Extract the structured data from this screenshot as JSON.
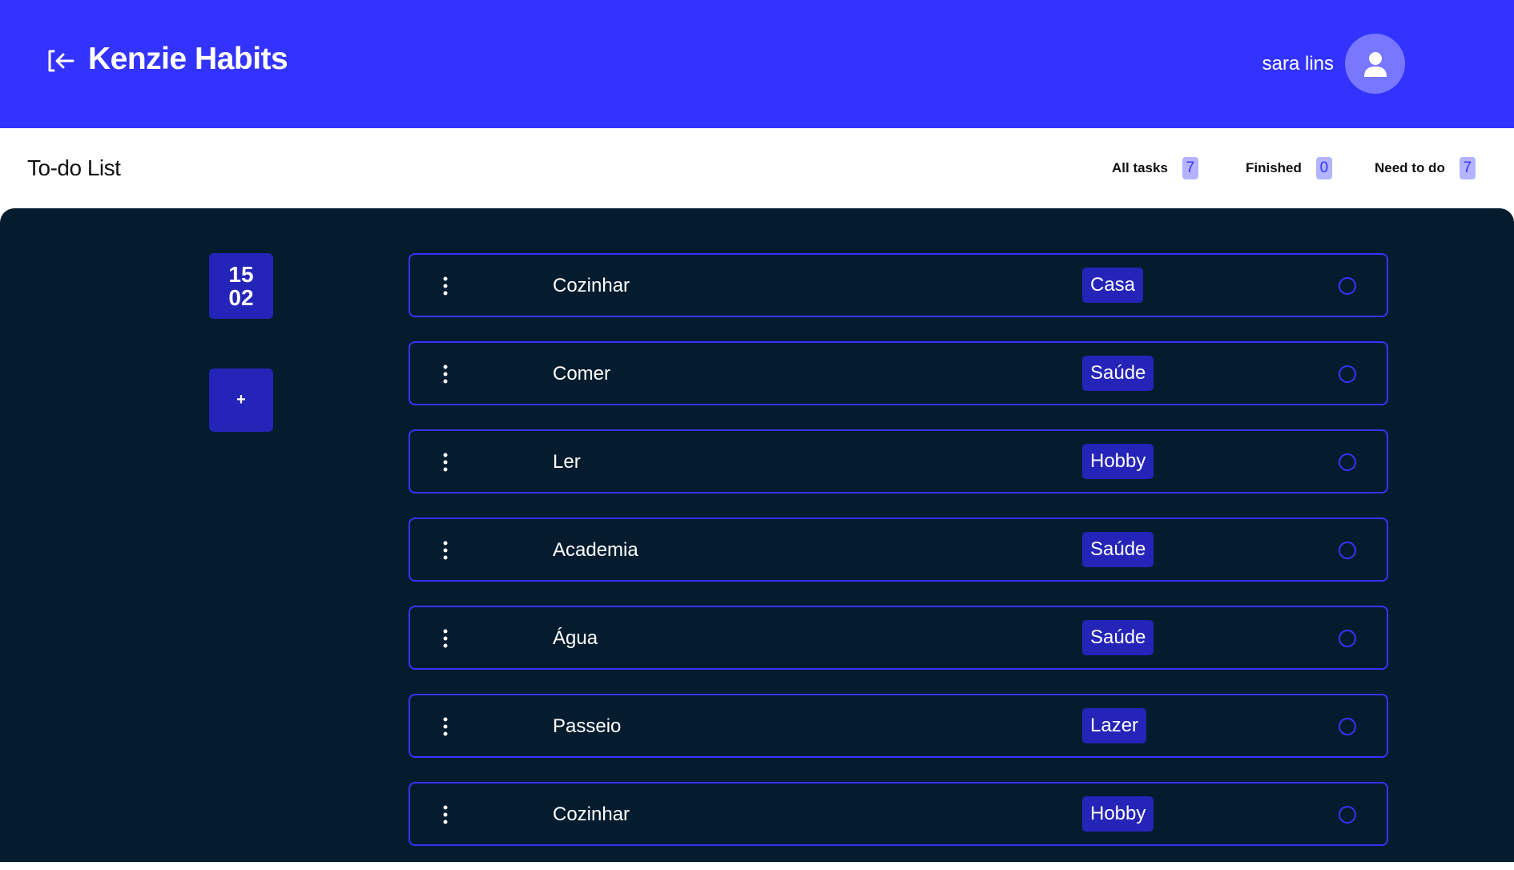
{
  "header": {
    "title": "Kenzie Habits",
    "user_name": "sara lins",
    "logout_icon": "logout-icon",
    "avatar_icon": "user-icon"
  },
  "subheader": {
    "title": "To-do List",
    "counters": [
      {
        "label": "All tasks",
        "value": "7"
      },
      {
        "label": "Finished",
        "value": "0"
      },
      {
        "label": "Need to do",
        "value": "7"
      }
    ]
  },
  "sidebar": {
    "date_day": "15",
    "date_month": "02",
    "add_label": "+"
  },
  "tasks": [
    {
      "title": "Cozinhar",
      "tag": "Casa"
    },
    {
      "title": "Comer",
      "tag": "Saúde"
    },
    {
      "title": "Ler",
      "tag": "Hobby"
    },
    {
      "title": "Academia",
      "tag": "Saúde"
    },
    {
      "title": "Água",
      "tag": "Saúde"
    },
    {
      "title": "Passeio",
      "tag": "Lazer"
    },
    {
      "title": "Cozinhar",
      "tag": "Hobby"
    }
  ],
  "colors": {
    "header_bg": "#3333ff",
    "main_bg": "#051c2f",
    "accent": "#2424b8",
    "border": "#3434ff",
    "badge_bg": "#b3b3ff"
  }
}
